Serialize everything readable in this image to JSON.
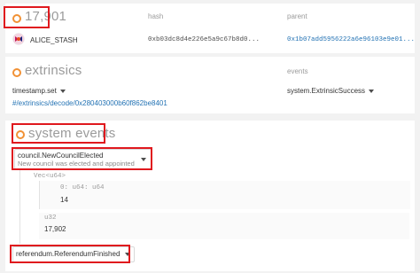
{
  "block": {
    "number": "17,901",
    "hash_header": "hash",
    "parent_header": "parent",
    "author": "ALICE_STASH",
    "hash": "0xb03dc8d4e226e5a9c67b8d0...",
    "parent": "0x1b07add5956222a6e96103e9e01..."
  },
  "extrinsics": {
    "title": "extrinsics",
    "events_header": "events",
    "item_method": "timestamp.set",
    "item_link": "#/extrinsics/decode/0x280403000b60f862be8401",
    "item_event": "system.ExtrinsicSuccess"
  },
  "system_events": {
    "title": "system events",
    "event1": {
      "name": "council.NewCouncilElected",
      "description": "New council was elected and appointed",
      "param1_type": "Vec<u64>",
      "param1_item_label": "0: u64: u64",
      "param1_item_value": "14",
      "param2_type": "u32",
      "param2_value": "17,902"
    },
    "event2": {
      "name": "referendum.ReferendumFinished"
    }
  },
  "colors": {
    "accent_orange": "#f19135",
    "highlight_red": "#e0191e",
    "link_blue": "#2473b4"
  },
  "icons": {
    "block_dot": "orange-ring-icon",
    "avatar": "identicon-avatar",
    "dropdown": "caret-down-icon"
  }
}
